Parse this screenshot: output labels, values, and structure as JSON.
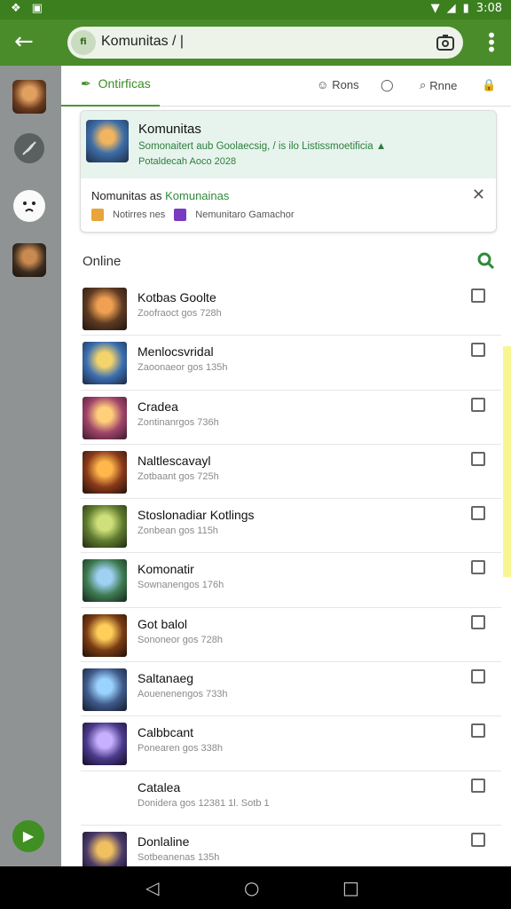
{
  "status": {
    "time": "3:08"
  },
  "toolbar": {
    "back_icon": "arrow-left-icon",
    "url_badge": "fi",
    "url_text": "Komunitas / |",
    "url_action_icon": "camera-icon",
    "menu_icon": "more-vert-icon"
  },
  "sidebar": {
    "items": [
      {
        "icon": "avatar-warrior-icon"
      },
      {
        "icon": "feather-icon"
      },
      {
        "icon": "ghost-face-icon"
      },
      {
        "icon": "avatar-gunner-icon"
      }
    ],
    "fab_icon": "play-icon"
  },
  "topnav": {
    "active_tab": "Ontirficas",
    "items": [
      {
        "label": "Rons",
        "icon": "person-icon"
      },
      {
        "label": "",
        "icon": "chat-bubble-icon"
      },
      {
        "label": "Rnne",
        "icon": "search-icon"
      },
      {
        "label": "",
        "icon": "lock-icon"
      }
    ]
  },
  "card": {
    "title": "Komunitas",
    "line1": "Somonaitert aub Goolaecsig, / is ilo Listissmoetificia ▲",
    "line2": "Potaldecah Aoco 2028",
    "row2_prefix": "Nomunitas as",
    "row2_accent": "Komunainas",
    "row3_item1": "Notirres nes",
    "row3_item2": "Nemunitaro Gamachor"
  },
  "section": {
    "title": "Online"
  },
  "list": [
    {
      "name": "Kotbas Goolte",
      "sub": "Zoofraoct gos 728h",
      "thumb": [
        "#f0a052",
        "#5c3a22",
        "#1f1510"
      ]
    },
    {
      "name": "Menlocsvridal",
      "sub": "Zaoonaeor gos 135h",
      "thumb": [
        "#f3d36b",
        "#3c6fb1",
        "#1b2740"
      ]
    },
    {
      "name": "Cradea",
      "sub": "Zontinanrgos 736h",
      "thumb": [
        "#ffcf7a",
        "#a0446a",
        "#3a1a2c"
      ]
    },
    {
      "name": "Naltlescavayl",
      "sub": "Zotbaant gos 725h",
      "thumb": [
        "#ffb64a",
        "#8a3a1a",
        "#20120c"
      ]
    },
    {
      "name": "Stoslonadiar Kotlings",
      "sub": "Zonbean gos 115h",
      "thumb": [
        "#cfe07a",
        "#5f7b2f",
        "#1e2a12"
      ]
    },
    {
      "name": "Komonatir",
      "sub": "Sownanengos 176h",
      "thumb": [
        "#9fd1f2",
        "#3f7b52",
        "#15261b"
      ]
    },
    {
      "name": "Got balol",
      "sub": "Sononeor gos 728h",
      "thumb": [
        "#ffcd5a",
        "#7a3c14",
        "#1e0f08"
      ]
    },
    {
      "name": "Saltanaeg",
      "sub": "Aouenenengos 733h",
      "thumb": [
        "#9bd3ff",
        "#3f5a8a",
        "#121a2a"
      ]
    },
    {
      "name": "Calbbcant",
      "sub": "Ponearen gos 338h",
      "thumb": [
        "#c7b0ff",
        "#4b3a8a",
        "#120c26"
      ]
    },
    {
      "name": "Catalea",
      "sub": "Donidera gos 12381 1l. Sotb 1",
      "thumb": [
        "#ffffff",
        "#ffffff",
        "#ffffff"
      ]
    },
    {
      "name": "Donlaline",
      "sub": "Sotbeanenas 135h",
      "thumb": [
        "#f0c060",
        "#4a3a6a",
        "#140f20"
      ]
    }
  ],
  "navbar": {
    "back_icon": "triangle-back-icon",
    "home_icon": "circle-home-icon",
    "recents_icon": "square-recents-icon"
  }
}
